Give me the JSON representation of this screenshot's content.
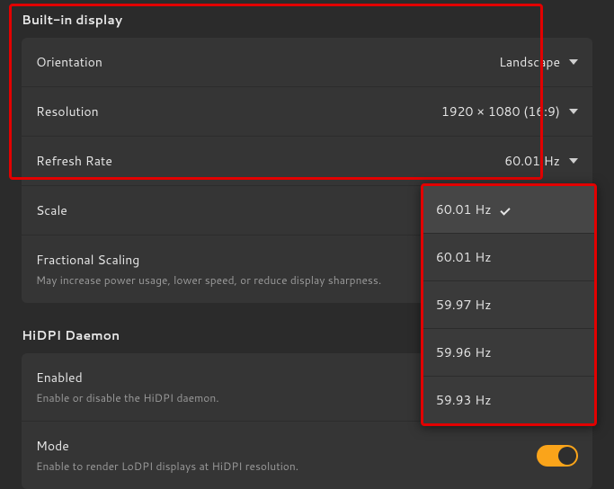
{
  "sections": {
    "builtin": {
      "title": "Built-in display",
      "rows": {
        "orientation": {
          "label": "Orientation",
          "value": "Landscape"
        },
        "resolution": {
          "label": "Resolution",
          "value": "1920 × 1080 (16:9)"
        },
        "refresh": {
          "label": "Refresh Rate",
          "value": "60.01 Hz"
        },
        "scale": {
          "label": "Scale"
        },
        "fractional": {
          "label": "Fractional Scaling",
          "sub": "May increase power usage, lower speed, or reduce display sharpness."
        }
      }
    },
    "hidpi": {
      "title": "HiDPI Daemon",
      "rows": {
        "enabled": {
          "label": "Enabled",
          "sub": "Enable or disable the HiDPI daemon."
        },
        "mode": {
          "label": "Mode",
          "sub": "Enable to render LoDPI displays at HiDPI resolution."
        }
      }
    }
  },
  "refresh_dropdown": {
    "items": [
      "60.01 Hz",
      "60.01 Hz",
      "59.97 Hz",
      "59.96 Hz",
      "59.93 Hz"
    ],
    "selected_index": 0
  },
  "toggles": {
    "mode_on": true
  }
}
